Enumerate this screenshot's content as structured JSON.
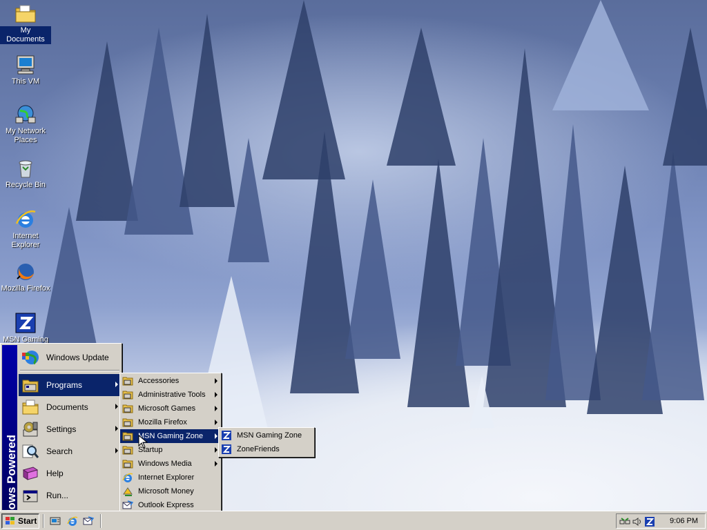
{
  "desktop": {
    "icons": [
      {
        "label": "My Documents",
        "icon": "folder-documents-icon"
      },
      {
        "label": "This VM",
        "icon": "computer-icon"
      },
      {
        "label": "My Network Places",
        "label_l1": "My Network",
        "label_l2": "Places",
        "icon": "network-icon"
      },
      {
        "label": "Recycle Bin",
        "icon": "recycle-bin-icon"
      },
      {
        "label": "Internet Explorer",
        "label_l1": "Internet",
        "label_l2": "Explorer",
        "icon": "internet-explorer-icon"
      },
      {
        "label": "Mozilla Firefox",
        "icon": "firefox-icon"
      },
      {
        "label": "MSN Gaming",
        "icon": "msn-gaming-icon"
      }
    ]
  },
  "start_menu": {
    "band_text": "Windows Powered",
    "items": [
      {
        "label": "Windows Update",
        "icon": "windows-update-icon",
        "arrow": false
      },
      {
        "label": "Programs",
        "icon": "programs-icon",
        "arrow": true,
        "highlighted": true
      },
      {
        "label": "Documents",
        "icon": "documents-icon",
        "arrow": true
      },
      {
        "label": "Settings",
        "icon": "settings-icon",
        "arrow": true
      },
      {
        "label": "Search",
        "icon": "search-icon",
        "arrow": true
      },
      {
        "label": "Help",
        "icon": "help-icon",
        "arrow": false
      },
      {
        "label": "Run...",
        "icon": "run-icon",
        "arrow": false
      }
    ]
  },
  "programs_menu": {
    "items": [
      {
        "label": "Accessories",
        "icon": "program-group-icon",
        "arrow": true
      },
      {
        "label": "Administrative Tools",
        "icon": "program-group-icon",
        "arrow": true
      },
      {
        "label": "Microsoft Games",
        "icon": "program-group-icon",
        "arrow": true
      },
      {
        "label": "Mozilla Firefox",
        "icon": "program-group-icon",
        "arrow": true
      },
      {
        "label": "MSN Gaming Zone",
        "icon": "program-group-icon",
        "arrow": true,
        "highlighted": true
      },
      {
        "label": "Startup",
        "icon": "program-group-icon",
        "arrow": true
      },
      {
        "label": "Windows Media",
        "icon": "program-group-icon",
        "arrow": true
      },
      {
        "label": "Internet Explorer",
        "icon": "internet-explorer-icon",
        "arrow": false
      },
      {
        "label": "Microsoft Money",
        "icon": "microsoft-money-icon",
        "arrow": false
      },
      {
        "label": "Outlook Express",
        "icon": "outlook-express-icon",
        "arrow": false
      }
    ]
  },
  "gaming_zone_menu": {
    "items": [
      {
        "label": "MSN Gaming Zone",
        "icon": "msn-zone-icon"
      },
      {
        "label": "ZoneFriends",
        "icon": "msn-zone-icon"
      }
    ]
  },
  "taskbar": {
    "start_label": "Start",
    "quick_launch": [
      "show-desktop-icon",
      "internet-explorer-icon",
      "outlook-express-icon"
    ],
    "tray_icons": [
      "network-tray-icon",
      "volume-icon",
      "msn-zone-tray-icon"
    ],
    "clock": "9:06 PM"
  },
  "colors": {
    "menu_face": "#d4d0c8",
    "highlight": "#0a246a",
    "band": "#000080"
  }
}
